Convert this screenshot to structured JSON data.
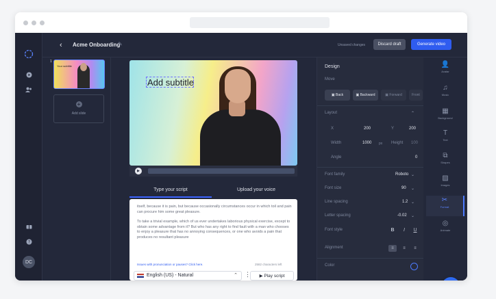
{
  "header": {
    "project_name": "Acme Onboarding",
    "unsaved_label": "Unsaved changes",
    "discard_label": "Discard draft",
    "generate_label": "Generate video"
  },
  "user": {
    "initials": "DC"
  },
  "slides": {
    "items": [
      {
        "number": "1",
        "thumb_text": "Your subtitle"
      }
    ],
    "add_label": "Add slide"
  },
  "canvas": {
    "subtitle_text": "Add subtitle"
  },
  "script_tabs": [
    "Type your script",
    "Upload your voice"
  ],
  "script": {
    "paragraphs": [
      "itself, because it is pain, but because occasionally circumstances occur in which toil and pain can procure him some great pleasure.",
      "To take a trivial example, which of us ever undertakes laborious physical exercise, except to obtain some advantage from it? But who has any right to find fault with a man who chooses to enjoy a pleasure that has no annoying consequences, or one who avoids a pain that produces no resultant pleasure"
    ],
    "help_link": "Issues with pronunciation or pauses? Click here.",
    "char_count": "2582 characters left",
    "language": "English (US) - Natural",
    "play_label": "Play script"
  },
  "panel": {
    "title": "Design",
    "move_label": "Move",
    "move_buttons": [
      "Back",
      "Backward",
      "Forward",
      "Front"
    ],
    "layout_label": "Layout",
    "x_label": "X",
    "x_value": "200",
    "y_label": "Y",
    "y_value": "200",
    "width_label": "Width",
    "width_value": "1000",
    "px_label": "px",
    "height_label": "Height",
    "height_value": "100",
    "angle_label": "Angle",
    "angle_value": "0",
    "font_family_label": "Font family",
    "font_family_value": "Roboto",
    "font_size_label": "Font size",
    "font_size_value": "90",
    "line_spacing_label": "Line spacing",
    "line_spacing_value": "1.2",
    "letter_spacing_label": "Letter spacing",
    "letter_spacing_value": "-0.02",
    "font_style_label": "Font style",
    "alignment_label": "Alignment",
    "color_label": "Color"
  },
  "tools": [
    "Avatar",
    "Music",
    "Background",
    "Text",
    "Shapes",
    "Images",
    "Format",
    "Animate"
  ]
}
